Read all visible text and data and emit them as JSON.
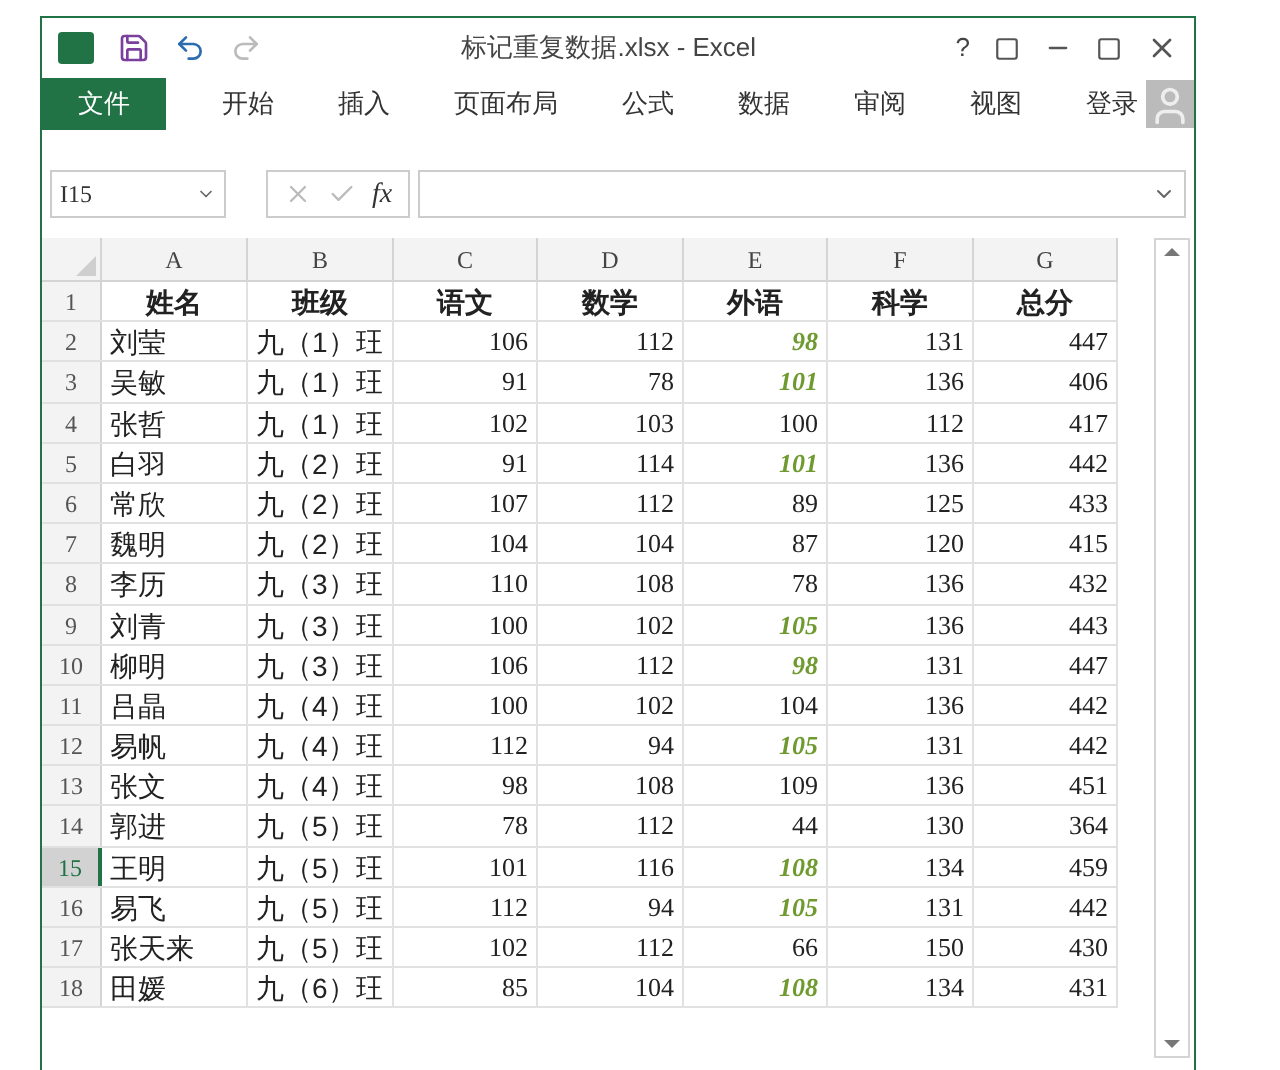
{
  "window": {
    "title": "标记重复数据.xlsx - Excel",
    "help": "?"
  },
  "ribbon_tabs": [
    {
      "label": "文件",
      "kind": "file"
    },
    {
      "label": "开始",
      "kind": "tab"
    },
    {
      "label": "插入",
      "kind": "tab"
    },
    {
      "label": "页面布局",
      "kind": "tab"
    },
    {
      "label": "公式",
      "kind": "tab"
    },
    {
      "label": "数据",
      "kind": "tab"
    },
    {
      "label": "审阅",
      "kind": "tab"
    },
    {
      "label": "视图",
      "kind": "tab"
    }
  ],
  "function_label": "fx",
  "sign_in": "登录",
  "name_box": "I15",
  "columns": [
    "A",
    "B",
    "C",
    "D",
    "E",
    "F",
    "G"
  ],
  "header_row": {
    "num": "1",
    "cells": [
      "姓名",
      "班级",
      "语文",
      "数学",
      "外语",
      "科学",
      "总分"
    ]
  },
  "rows": [
    {
      "num": "2",
      "selected": false,
      "cells": [
        "刘莹",
        "九（1）玨",
        "106",
        "112",
        "98",
        "131",
        "447"
      ],
      "highlighted": true
    },
    {
      "num": "3",
      "selected": false,
      "cells": [
        "吴敏",
        "九（1）玨",
        "91",
        "78",
        "101",
        "136",
        "406"
      ],
      "highlighted": true
    },
    {
      "num": "4",
      "selected": false,
      "cells": [
        "张哲",
        "九（1）玨",
        "102",
        "103",
        "100",
        "112",
        "417"
      ],
      "highlighted": false
    },
    {
      "num": "5",
      "selected": false,
      "cells": [
        "白羽",
        "九（2）玨",
        "91",
        "114",
        "101",
        "136",
        "442"
      ],
      "highlighted": true
    },
    {
      "num": "6",
      "selected": false,
      "cells": [
        "常欣",
        "九（2）玨",
        "107",
        "112",
        "89",
        "125",
        "433"
      ],
      "highlighted": false
    },
    {
      "num": "7",
      "selected": false,
      "cells": [
        "魏明",
        "九（2）玨",
        "104",
        "104",
        "87",
        "120",
        "415"
      ],
      "highlighted": false
    },
    {
      "num": "8",
      "selected": false,
      "cells": [
        "李历",
        "九（3）玨",
        "110",
        "108",
        "78",
        "136",
        "432"
      ],
      "highlighted": false
    },
    {
      "num": "9",
      "selected": false,
      "cells": [
        "刘青",
        "九（3）玨",
        "100",
        "102",
        "105",
        "136",
        "443"
      ],
      "highlighted": true
    },
    {
      "num": "10",
      "selected": false,
      "cells": [
        "柳明",
        "九（3）玨",
        "106",
        "112",
        "98",
        "131",
        "447"
      ],
      "highlighted": true
    },
    {
      "num": "11",
      "selected": false,
      "cells": [
        "吕晶",
        "九（4）玨",
        "100",
        "102",
        "104",
        "136",
        "442"
      ],
      "highlighted": false
    },
    {
      "num": "12",
      "selected": false,
      "cells": [
        "易帆",
        "九（4）玨",
        "112",
        "94",
        "105",
        "131",
        "442"
      ],
      "highlighted": true
    },
    {
      "num": "13",
      "selected": false,
      "cells": [
        "张文",
        "九（4）玨",
        "98",
        "108",
        "109",
        "136",
        "451"
      ],
      "highlighted": false
    },
    {
      "num": "14",
      "selected": false,
      "cells": [
        "郭进",
        "九（5）玨",
        "78",
        "112",
        "44",
        "130",
        "364"
      ],
      "highlighted": false
    },
    {
      "num": "15",
      "selected": true,
      "cells": [
        "王明",
        "九（5）玨",
        "101",
        "116",
        "108",
        "134",
        "459"
      ],
      "highlighted": true
    },
    {
      "num": "16",
      "selected": false,
      "cells": [
        "易飞",
        "九（5）玨",
        "112",
        "94",
        "105",
        "131",
        "442"
      ],
      "highlighted": true
    },
    {
      "num": "17",
      "selected": false,
      "cells": [
        "张天来",
        "九（5）玨",
        "102",
        "112",
        "66",
        "150",
        "430"
      ],
      "highlighted": false
    },
    {
      "num": "18",
      "selected": false,
      "cells": [
        "田媛",
        "九（6）玨",
        "85",
        "104",
        "108",
        "134",
        "431"
      ],
      "highlighted": true
    }
  ]
}
